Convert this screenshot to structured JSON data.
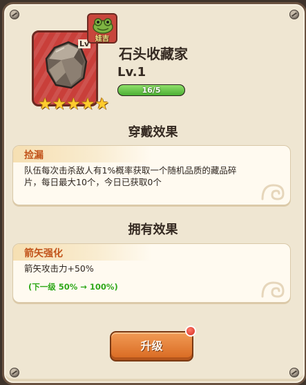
{
  "card": {
    "name": "石头收藏家",
    "level_text": "Lv.1",
    "level_tag": "Lv",
    "stars": 5,
    "xp_text": "16/5",
    "xp_fill_fraction": 1.0,
    "rarity_color": "#c93f3a",
    "item_icon": "rock-icon",
    "badge": {
      "icon": "frog-icon",
      "label": "娃吉"
    }
  },
  "wear_effect": {
    "heading": "穿戴效果",
    "title": "捡漏",
    "text": "队伍每次击杀敌人有1%概率获取一个随机品质的藏品碎片，每日最大10个，今日已获取0个"
  },
  "own_effect": {
    "heading": "拥有效果",
    "title": "箭矢强化",
    "text": "箭矢攻击力+50%",
    "next_level": "(下一级 50% → 100%)"
  },
  "upgrade": {
    "label": "升级",
    "has_notification": true
  },
  "colors": {
    "accent_orange": "#d86820",
    "title_orange": "#c2541b",
    "green_text": "#2fa81a",
    "xp_green": "#4caf34"
  }
}
